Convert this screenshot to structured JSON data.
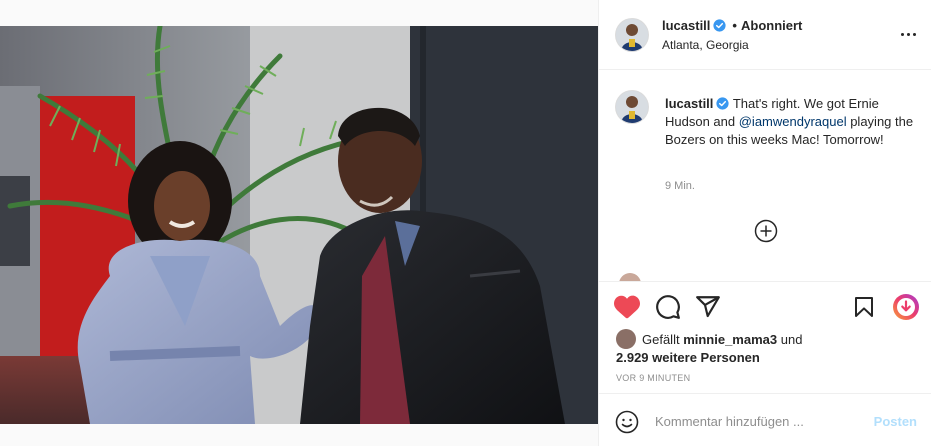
{
  "post": {
    "username": "lucastill",
    "separator": "•",
    "follow_status": "Abonniert",
    "location": "Atlanta, Georgia"
  },
  "caption": {
    "username": "lucastill",
    "text_before": "That's right. We got Ernie Hudson and ",
    "mention": "@iamwendyraquel",
    "text_after": " playing the Bozers on this weeks Mac! Tomorrow!",
    "time": "9 Min."
  },
  "likes": {
    "prefix": "Gefällt ",
    "liked_by": "minnie_mama3",
    "middle": " und",
    "others": "2.929 weitere Personen"
  },
  "post_date": "VOR 9 MINUTEN",
  "comment_box": {
    "placeholder": "Kommentar hinzufügen ...",
    "post_label": "Posten"
  },
  "colors": {
    "heart": "#ed4956",
    "verified": "#3897f0",
    "mention": "#00376b",
    "post_button_disabled": "#b2dffc"
  },
  "icons": {
    "more": "more-options-icon",
    "like": "heart-filled-icon",
    "comment": "comment-bubble-icon",
    "share": "paper-plane-icon",
    "save": "bookmark-icon",
    "extension": "download-circle-icon",
    "load_more": "plus-circle-icon",
    "emoji": "smiley-icon",
    "verified": "verified-badge-icon"
  }
}
